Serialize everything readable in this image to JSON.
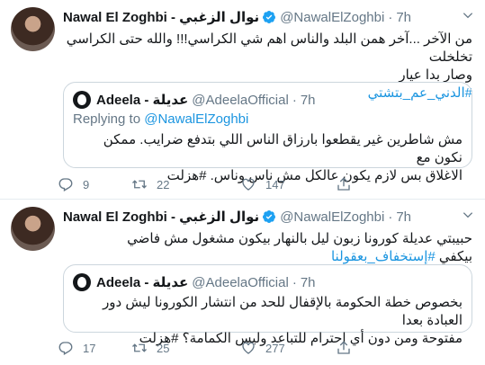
{
  "tweets": [
    {
      "author_name": "Nawal El Zoghbi - نوال الزغبي",
      "handle": "@NawalElZoghbi",
      "time": "7h",
      "text_line1": "من الآخر ...آخر همن البلد والناس      اهم شي الكراسي!!! والله حتى الكراسي تخلخلت",
      "text_line2": "وصار بدا عيار",
      "hashtag": "#الدني_عم_بتشتي",
      "quote": {
        "author_name": "Adeela - عديلة",
        "handle": "@AdeelaOfficial",
        "time": "7h",
        "replying_label": "Replying to",
        "replying_handle": "@NawalElZoghbi",
        "text_line1": "مش شاطرين غير يقطعوا بارزاق الناس اللي بتدفع ضرايب. ممكن نكون مع",
        "text_line2": "الاغلاق بس لازم يكون عالكل مش ناس وناس. #هزلت"
      },
      "replies": "9",
      "retweets": "22",
      "likes": "147"
    },
    {
      "author_name": "Nawal El Zoghbi - نوال الزغبي",
      "handle": "@NawalElZoghbi",
      "time": "7h",
      "text_line1": "حبيبتي عديلة كورونا زبون ليل بالنهار بيكون مشغول مش فاضي",
      "text_prefix": "بيكفي",
      "hashtag": "#إستخفاف_بعقولنا",
      "quote": {
        "author_name": "Adeela - عديلة",
        "handle": "@AdeelaOfficial",
        "time": "7h",
        "text_line1": "بخصوص خطة الحكومة بالإقفال للحد من انتشار الكورونا ليش دور العبادة بعدا",
        "text_line2": "مفتوحة ومن دون أي احترام للتباعد وليس الكمامة؟ #هزلت"
      },
      "replies": "17",
      "retweets": "25",
      "likes": "277"
    }
  ],
  "colors": {
    "accent": "#1da1f2",
    "link": "#1b95e0",
    "muted": "#657786",
    "border": "#e6ecf0"
  },
  "icons": [
    "verified-icon",
    "chevron-down-icon",
    "reply-icon",
    "retweet-icon",
    "like-icon",
    "share-icon"
  ]
}
